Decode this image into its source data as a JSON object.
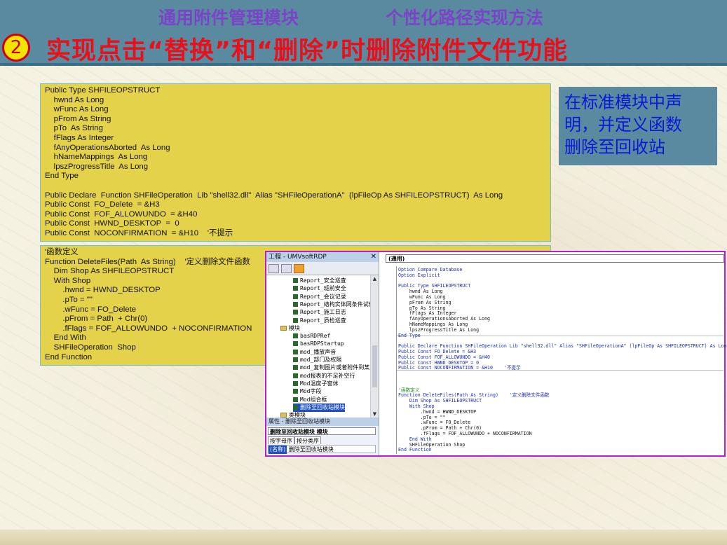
{
  "header": {
    "subtitle_left": "通用附件管理模块",
    "subtitle_right": "个性化路径实现方法",
    "step_number": "2",
    "title": "实现点击“替换”和“删除”时删除附件文件功能"
  },
  "code_box_1": {
    "lines": [
      "Public Type SHFILEOPSTRUCT",
      "    hwnd As Long",
      "    wFunc As Long",
      "    pFrom As String",
      "    pTo  As String",
      "    fFlags As Integer",
      "    fAnyOperationsAborted  As Long",
      "    hNameMappings  As Long",
      "    lpszProgressTitle  As Long",
      "End Type",
      "",
      "Public Declare  Function SHFileOperation  Lib \"shell32.dll\"  Alias \"SHFileOperationA\"  (lpFileOp As SHFILEOPSTRUCT)  As Long",
      "Public Const  FO_Delete  = &H3",
      "Public Const  FOF_ALLOWUNDO  = &H40",
      "Public Const  HWND_DESKTOP  =  0",
      "Public Const  NOCONFIRMATION  = &H10    '不提示"
    ]
  },
  "code_box_2": {
    "lines": [
      "'函数定义",
      "Function DeleteFiles(Path  As String)    '定义删除文件函数",
      "    Dim Shop As SHFILEOPSTRUCT",
      "    With Shop",
      "        .hwnd = HWND_DESKTOP",
      "        .pTo = \"\"",
      "        .wFunc = FO_Delete",
      "        .pFrom = Path  + Chr(0)",
      "        .fFlags = FOF_ALLOWUNDO  + NOCONFIRMATION",
      "    End With",
      "    SHFileOperation  Shop",
      "End Function"
    ]
  },
  "note": {
    "text_line1": "在标准模块中声",
    "text_line2": "明，并定义函数",
    "text_line3": "删除至回收站"
  },
  "vbe": {
    "project_title": "工程 - UMVsoftRDP",
    "close_label": "✕",
    "tree_items": [
      "Report_安全巡查",
      "Report_班前安全",
      "Report_会议记录",
      "Report_结构实体网条件试件",
      "Report_施工日志",
      "Report_质检巡查",
      "模块",
      "basRDPRef",
      "basRDPStartup",
      "mod_播放声音",
      "mod_部门及权限",
      "mod_复制图片或者附件到某",
      "mod报表的不足补空行",
      "Mod温度子窗体",
      "Mod字段",
      "Mod组合框",
      "删除至回收站模块",
      "类模块"
    ],
    "props_title": "属性 - 删除至回收站模块",
    "props_object": "删除至回收站模块  模块",
    "props_tab_alpha": "按字母序",
    "props_tab_category": "按分类序",
    "props_key": "(名称)",
    "props_value": "删除至回收站模块",
    "code_dropdown": "(通用)",
    "code_lines": [
      {
        "t": "Option Compare Database",
        "c": "kw"
      },
      {
        "t": "Option Explicit",
        "c": "kw"
      },
      {
        "t": "",
        "c": ""
      },
      {
        "t": "Public Type SHFILEOPSTRUCT",
        "c": "kw"
      },
      {
        "t": "    hwnd As Long",
        "c": ""
      },
      {
        "t": "    wFunc As Long",
        "c": ""
      },
      {
        "t": "    pFrom As String",
        "c": ""
      },
      {
        "t": "    pTo As String",
        "c": ""
      },
      {
        "t": "    fFlags As Integer",
        "c": ""
      },
      {
        "t": "    fAnyOperationsAborted As Long",
        "c": ""
      },
      {
        "t": "    hNameMappings As Long",
        "c": ""
      },
      {
        "t": "    lpszProgressTitle As Long",
        "c": ""
      },
      {
        "t": "End Type",
        "c": "kw"
      },
      {
        "t": "",
        "c": ""
      },
      {
        "t": "Public Declare Function SHFileOperation Lib \"shell32.dll\" Alias \"SHFileOperationA\" (lpFileOp As SHFILEOPSTRUCT) As Long",
        "c": "kw"
      },
      {
        "t": "Public Const FO_Delete = &H3",
        "c": "kw"
      },
      {
        "t": "Public Const FOF_ALLOWUNDO = &H40",
        "c": "kw"
      },
      {
        "t": "Public Const HWND_DESKTOP = 0",
        "c": "kw"
      },
      {
        "t": "Public Const NOCONFIRMATION = &H10    '不提示",
        "c": "kw"
      },
      {
        "t": "",
        "c": ""
      },
      {
        "t": "",
        "c": ""
      },
      {
        "t": "",
        "c": ""
      },
      {
        "t": "'函数定义",
        "c": "cm"
      },
      {
        "t": "Function DeleteFiles(Path As String)    '定义删除文件函数",
        "c": "kw"
      },
      {
        "t": "    Dim Shop As SHFILEOPSTRUCT",
        "c": "kw"
      },
      {
        "t": "    With Shop",
        "c": "kw"
      },
      {
        "t": "        .hwnd = HWND_DESKTOP",
        "c": ""
      },
      {
        "t": "        .pTo = \"\"",
        "c": ""
      },
      {
        "t": "        .wFunc = FO_Delete",
        "c": ""
      },
      {
        "t": "        .pFrom = Path + Chr(0)",
        "c": ""
      },
      {
        "t": "        .fFlags = FOF_ALLOWUNDO + NOCONFIRMATION",
        "c": ""
      },
      {
        "t": "    End With",
        "c": "kw"
      },
      {
        "t": "    SHFileOperation Shop",
        "c": ""
      },
      {
        "t": "End Function",
        "c": "kw"
      }
    ]
  }
}
